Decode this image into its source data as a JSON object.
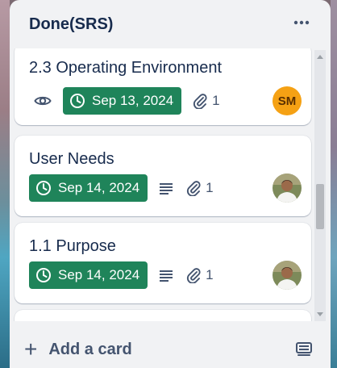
{
  "list": {
    "title": "Done(SRS)",
    "menu_icon": "more-horizontal-icon",
    "add_card_label": "Add a card",
    "template_icon": "card-template-icon"
  },
  "cards": [
    {
      "title": "2.3 Operating Environment",
      "watch_icon": "eye-icon",
      "due_date": "Sep 13, 2024",
      "attachments": "1",
      "member": {
        "type": "initials",
        "initials": "SM",
        "color": "#f5a114"
      }
    },
    {
      "title": "User Needs",
      "due_date": "Sep 14, 2024",
      "description_icon": "description-icon",
      "attachments": "1",
      "member": {
        "type": "photo",
        "name": "avatar-photo"
      }
    },
    {
      "title": "1.1 Purpose",
      "due_date": "Sep 14, 2024",
      "description_icon": "description-icon",
      "attachments": "1",
      "member": {
        "type": "photo",
        "name": "avatar-photo"
      }
    }
  ],
  "colors": {
    "due_badge": "#1f845a",
    "list_bg": "#f1f2f4",
    "title_text": "#172b4d",
    "muted_text": "#44546f"
  }
}
